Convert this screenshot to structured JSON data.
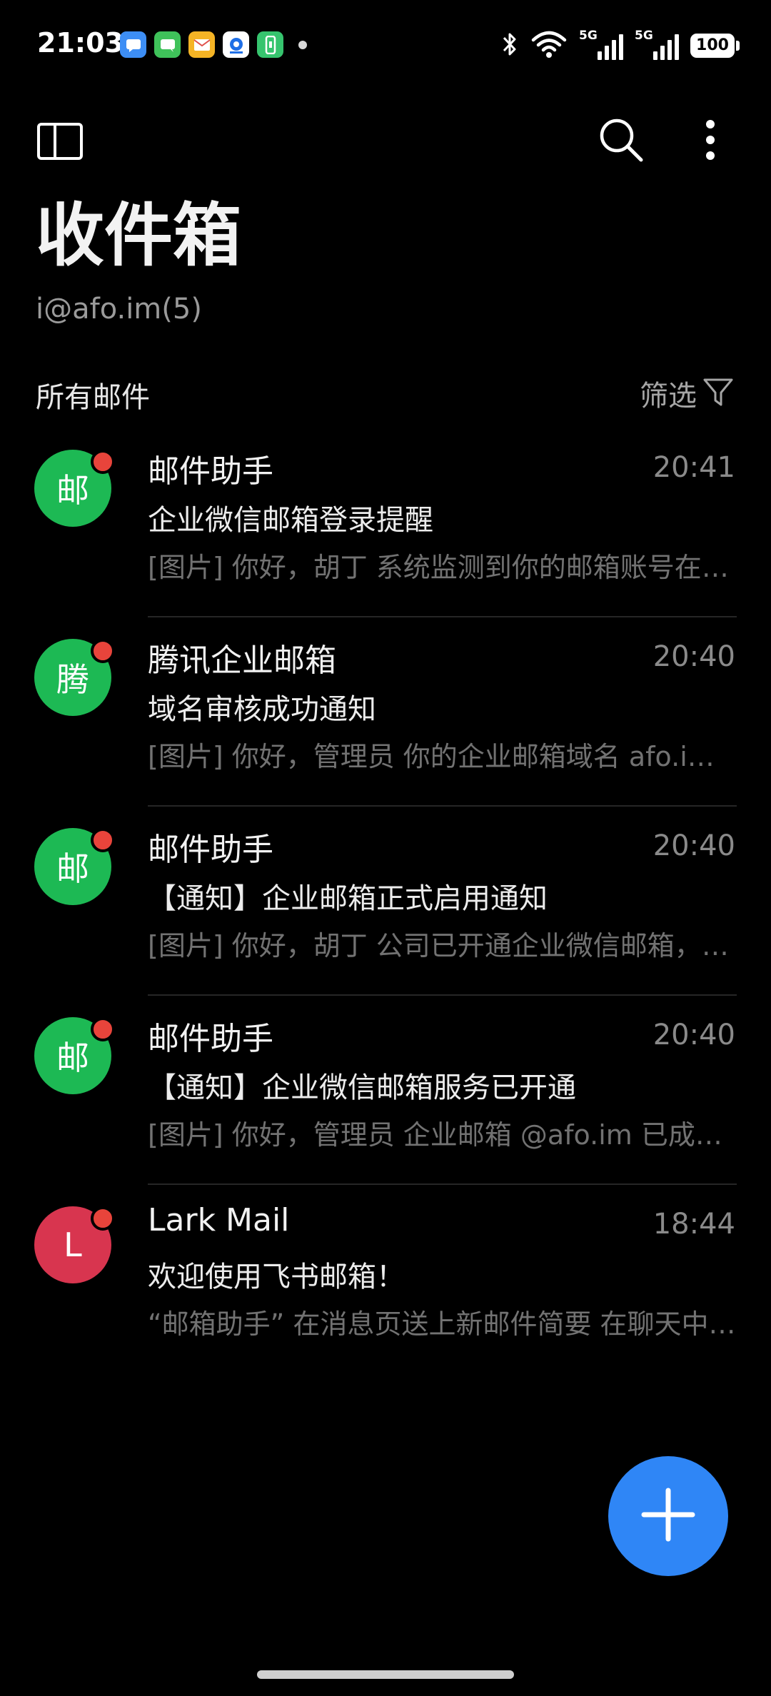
{
  "status_bar": {
    "time": "21:03",
    "notification_icons": [
      {
        "name": "messages-app-icon",
        "color": "#3d8ef5"
      },
      {
        "name": "chat-app-icon",
        "color": "#3fc25a"
      },
      {
        "name": "mail-app-icon",
        "color": "#f5b425"
      },
      {
        "name": "browser-app-icon",
        "color": "#ffffff"
      },
      {
        "name": "phone-app-icon",
        "color": "#36c46e"
      }
    ],
    "signal_1_label": "5G",
    "signal_2_label": "5G",
    "battery": "100"
  },
  "header": {
    "title": "收件箱",
    "account": "i@afo.im(5)",
    "section": "所有邮件",
    "filter_label": "筛选"
  },
  "mails": [
    {
      "avatar_letter": "邮",
      "avatar_color": "#1db954",
      "sender": "邮件助手",
      "time": "20:41",
      "subject": "企业微信邮箱登录提醒",
      "preview": "[图片] 你好，胡丁  系统监测到你的邮箱账号在新设备上登录",
      "unread": true
    },
    {
      "avatar_letter": "腾",
      "avatar_color": "#1db954",
      "sender": "腾讯企业邮箱",
      "time": "20:40",
      "subject": "域名审核成功通知",
      "preview": "[图片] 你好，管理员  你的企业邮箱域名 afo.im 已审核通过",
      "unread": true
    },
    {
      "avatar_letter": "邮",
      "avatar_color": "#1db954",
      "sender": "邮件助手",
      "time": "20:40",
      "subject": "【通知】企业邮箱正式启用通知",
      "preview": "[图片] 你好，胡丁  公司已开通企业微信邮箱，欢迎使用",
      "unread": true
    },
    {
      "avatar_letter": "邮",
      "avatar_color": "#1db954",
      "sender": "邮件助手",
      "time": "20:40",
      "subject": "【通知】企业微信邮箱服务已开通",
      "preview": "[图片] 你好，管理员  企业邮箱 @afo.im 已成功开通",
      "unread": true
    },
    {
      "avatar_letter": "L",
      "avatar_color": "#d8354f",
      "sender": "Lark Mail",
      "time": "18:44",
      "subject": "欢迎使用飞书邮箱！",
      "preview": "“邮箱助手” 在消息页送上新邮件简要  在聊天中即可查看",
      "unread": true
    }
  ],
  "accent_color": "#2f86f6"
}
